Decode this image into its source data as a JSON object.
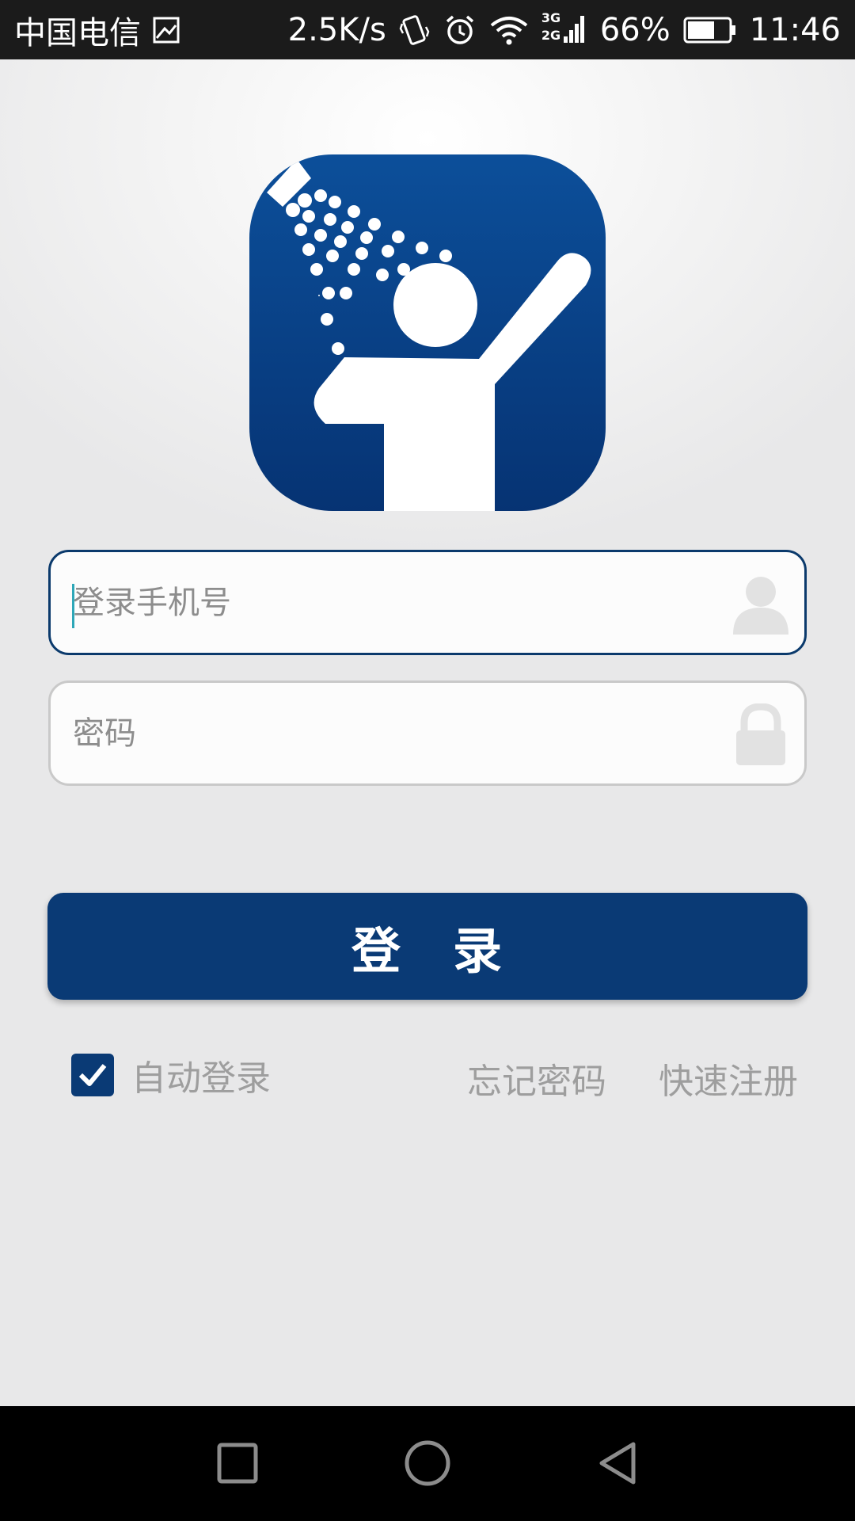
{
  "status_bar": {
    "carrier": "中国电信",
    "net_speed": "2.5K/s",
    "network_type_top": "3G",
    "network_type_bottom": "2G",
    "battery_percent": "66%",
    "battery_level": 0.66,
    "time": "11:46"
  },
  "login_form": {
    "phone_placeholder": "登录手机号",
    "phone_value": "",
    "password_placeholder": "密码",
    "password_value": "",
    "login_button_label": "登　录"
  },
  "options": {
    "auto_login_label": "自动登录",
    "auto_login_checked": true,
    "forgot_password_label": "忘记密码",
    "quick_register_label": "快速注册"
  },
  "colors": {
    "brand_blue": "#0a3a75",
    "logo_blue": "#0c4a93",
    "status_bar_bg": "#1b1b1b",
    "page_bg": "#e8e8e9",
    "muted_text": "#9e9e9e"
  },
  "icons": {
    "status": [
      "image-notification-icon",
      "vibrate-icon",
      "alarm-icon",
      "wifi-icon",
      "signal-icon",
      "battery-icon"
    ],
    "fields": [
      "user-icon",
      "lock-icon"
    ],
    "nav": [
      "recent-apps-icon",
      "home-icon",
      "back-icon"
    ]
  }
}
